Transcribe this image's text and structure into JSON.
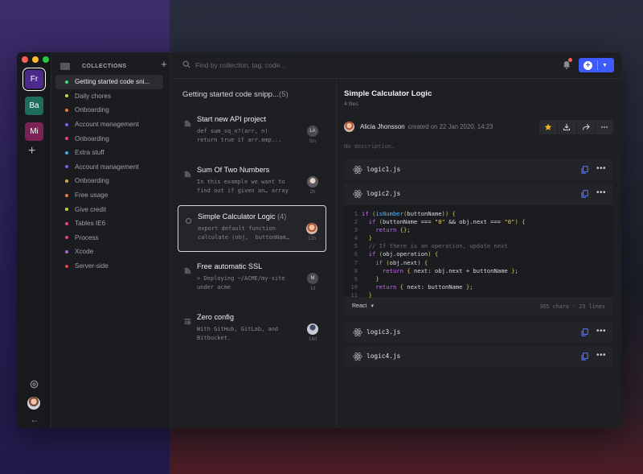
{
  "window": {
    "traffic_lights": [
      "#ff5f57",
      "#febc2e",
      "#28c840"
    ]
  },
  "rail": {
    "workspaces": [
      {
        "initials": "Fr",
        "color": "#4b2a8c",
        "active": true
      },
      {
        "initials": "Ba",
        "color": "#1f6b5c",
        "active": false
      },
      {
        "initials": "Mi",
        "color": "#7a2256",
        "active": false
      }
    ],
    "add_glyph": "+",
    "back_glyph": "←"
  },
  "collections": {
    "title": "COLLECTIONS",
    "add_glyph": "+",
    "items": [
      {
        "label": "Getting started code sni...",
        "color": "#3ddc84",
        "active": true
      },
      {
        "label": "Daily chores",
        "color": "#c6d43a"
      },
      {
        "label": "Onboarding",
        "color": "#f07a3a"
      },
      {
        "label": "Account management",
        "color": "#7b5cf0"
      },
      {
        "label": "Onboarding",
        "color": "#e0457b"
      },
      {
        "label": "Extra stuff",
        "color": "#3ab0e0"
      },
      {
        "label": "Account management",
        "color": "#7b5cf0"
      },
      {
        "label": "Onboarding",
        "color": "#e2a33a"
      },
      {
        "label": "Free usage",
        "color": "#f07a3a"
      },
      {
        "label": "Give credit",
        "color": "#c6d43a"
      },
      {
        "label": "Tables IE6",
        "color": "#e0457b"
      },
      {
        "label": "Process",
        "color": "#e0457b"
      },
      {
        "label": "Xcode",
        "color": "#a06ae0"
      },
      {
        "label": "Server-side",
        "color": "#e04545"
      }
    ]
  },
  "search": {
    "placeholder": "Find by collection, tag, code..."
  },
  "list": {
    "title": "Getting started code snipp...",
    "count": "(5)",
    "snippets": [
      {
        "title": "Start new API project",
        "count": "",
        "code": "def sum_sq_n?(arr, n)\nreturn true if arr.emp...",
        "avatar": "LA",
        "time": "5m",
        "icon": "code-block-icon",
        "selected": false
      },
      {
        "title": "Sum Of Two Numbers",
        "count": "",
        "code": "In this example we want to\nfind out if given an… array",
        "avatar": "",
        "time": "2h",
        "icon": "code-block-icon",
        "selected": false
      },
      {
        "title": "Simple Calculator Logic",
        "count": "(4)",
        "code": "export default function\ncalculate (obj,  buttonNam…",
        "avatar": "",
        "time": "12h",
        "icon": "gear-icon",
        "selected": true
      },
      {
        "title": "Free automatic SSL",
        "count": "",
        "code": "> Deploying ~/ACME/my-site\nunder acme",
        "avatar": "M",
        "time": "1d",
        "icon": "code-block-icon",
        "selected": false
      },
      {
        "title": "Zero config",
        "count": "",
        "code": "With GitHub, GitLab, and\nBitbucket.",
        "avatar": "",
        "time": "14d",
        "icon": "table-icon",
        "selected": false
      }
    ]
  },
  "detail": {
    "title": "Simple Calculator Logic",
    "files_count": "4 files",
    "author": "Alicia Jhonsson",
    "created": "created on 22 Jan 2020, 14:23",
    "description": "No description.",
    "files": [
      {
        "name": "logic1.js"
      },
      {
        "name": "logic2.js",
        "expanded": true
      },
      {
        "name": "logic3.js"
      },
      {
        "name": "logic4.js"
      }
    ],
    "code_lines": [
      {
        "n": "1",
        "t": "if (isNumber(buttonName)) {"
      },
      {
        "n": "2",
        "t": "  if (buttonName === \"0\" && obj.next === \"0\") {"
      },
      {
        "n": "3",
        "t": "    return {};"
      },
      {
        "n": "4",
        "t": "  }"
      },
      {
        "n": "5",
        "t": "  // If there is an operation, update next"
      },
      {
        "n": "6",
        "t": "  if (obj.operation) {"
      },
      {
        "n": "7",
        "t": "    if (obj.next) {"
      },
      {
        "n": "8",
        "t": "      return { next: obj.next + buttonName };"
      },
      {
        "n": "9",
        "t": "    }"
      },
      {
        "n": "10",
        "t": "    return { next: buttonName };"
      },
      {
        "n": "11",
        "t": "  }"
      }
    ],
    "language": "React",
    "chars": "365 chars",
    "lines": "23 lines"
  }
}
